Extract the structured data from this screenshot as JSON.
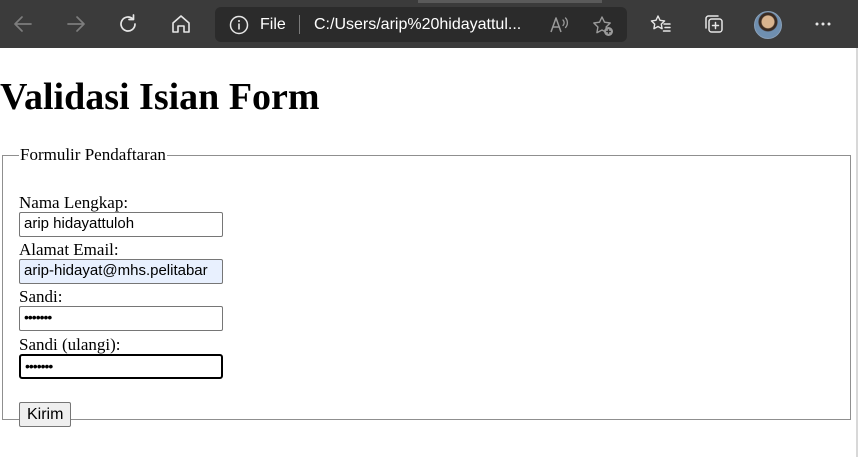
{
  "browser": {
    "address_scheme": "File",
    "address_url": "C:/Users/arip%20hidayattul...",
    "icons": [
      "back-icon",
      "forward-icon",
      "refresh-icon",
      "home-icon",
      "info-icon",
      "read-aloud-icon",
      "add-favorite-icon",
      "favorites-icon",
      "collections-icon",
      "profile-avatar",
      "more-icon"
    ],
    "colors": {
      "toolbar_bg": "#3b3b3b",
      "address_bg": "#2b2b2b"
    }
  },
  "page": {
    "heading": "Validasi Isian Form",
    "form": {
      "legend": "Formulir Pendaftaran",
      "name_label": "Nama Lengkap:",
      "name_value": "arip hidayattuloh",
      "email_label": "Alamat Email:",
      "email_value": "arip-hidayat@mhs.pelitabar",
      "password_label": "Sandi:",
      "password_value": "•••••••",
      "password_repeat_label": "Sandi (ulangi):",
      "password_repeat_value": "•••••••",
      "submit_label": "Kirim"
    }
  }
}
